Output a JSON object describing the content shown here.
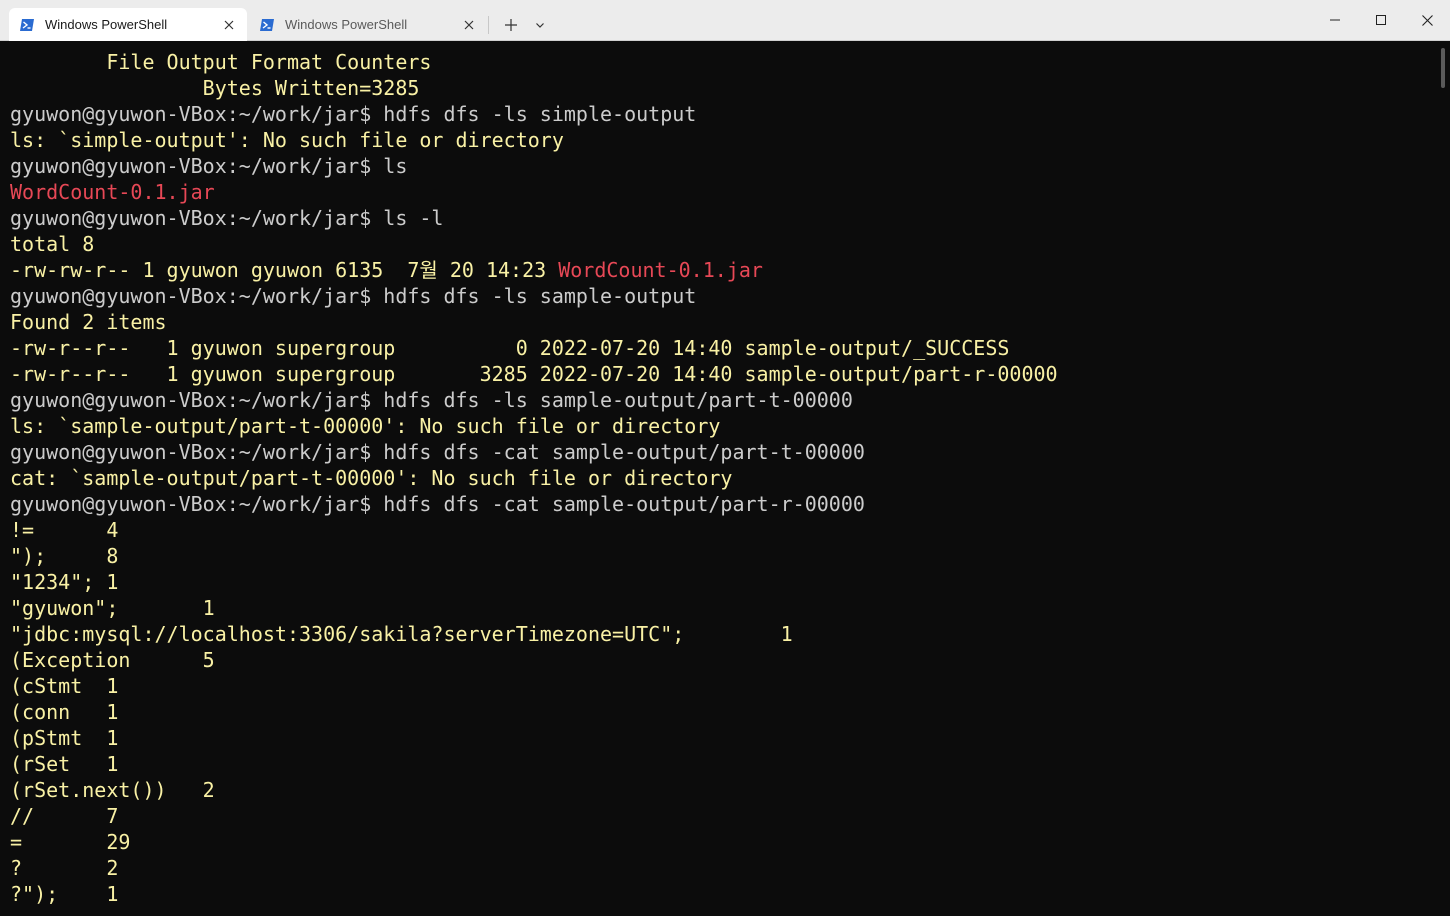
{
  "window": {
    "tabs": [
      {
        "label": "Windows PowerShell",
        "active": true
      },
      {
        "label": "Windows PowerShell",
        "active": false
      }
    ]
  },
  "colors": {
    "background": "#0c0c0c",
    "foreground": "#cccccc",
    "red": "#e74856",
    "yellow": "#f9f1a5"
  },
  "terminal": {
    "lines": [
      [
        {
          "t": "        File Output Format Counters",
          "c": "y"
        }
      ],
      [
        {
          "t": "                Bytes Written=3285",
          "c": "y"
        }
      ],
      [
        {
          "t": "gyuwon@gyuwon-VBox:~/work/jar$ hdfs dfs -ls simple-output",
          "c": ""
        }
      ],
      [
        {
          "t": "ls: `simple-output': No such file or directory",
          "c": "y"
        }
      ],
      [
        {
          "t": "gyuwon@gyuwon-VBox:~/work/jar$ ls",
          "c": ""
        }
      ],
      [
        {
          "t": "WordCount-0.1.jar",
          "c": "r"
        }
      ],
      [
        {
          "t": "gyuwon@gyuwon-VBox:~/work/jar$ ls -l",
          "c": ""
        }
      ],
      [
        {
          "t": "total 8",
          "c": "y"
        }
      ],
      [
        {
          "t": "-rw-rw-r-- 1 gyuwon gyuwon 6135  7월 20 14:23 ",
          "c": "y"
        },
        {
          "t": "WordCount-0.1.jar",
          "c": "r"
        }
      ],
      [
        {
          "t": "gyuwon@gyuwon-VBox:~/work/jar$ hdfs dfs -ls sample-output",
          "c": ""
        }
      ],
      [
        {
          "t": "Found 2 items",
          "c": "y"
        }
      ],
      [
        {
          "t": "-rw-r--r--   1 gyuwon supergroup          0 2022-07-20 14:40 sample-output/_SUCCESS",
          "c": "y"
        }
      ],
      [
        {
          "t": "-rw-r--r--   1 gyuwon supergroup       3285 2022-07-20 14:40 sample-output/part-r-00000",
          "c": "y"
        }
      ],
      [
        {
          "t": "gyuwon@gyuwon-VBox:~/work/jar$ hdfs dfs -ls sample-output/part-t-00000",
          "c": ""
        }
      ],
      [
        {
          "t": "ls: `sample-output/part-t-00000': No such file or directory",
          "c": "y"
        }
      ],
      [
        {
          "t": "gyuwon@gyuwon-VBox:~/work/jar$ hdfs dfs -cat sample-output/part-t-00000",
          "c": ""
        }
      ],
      [
        {
          "t": "cat: `sample-output/part-t-00000': No such file or directory",
          "c": "y"
        }
      ],
      [
        {
          "t": "gyuwon@gyuwon-VBox:~/work/jar$ hdfs dfs -cat sample-output/part-r-00000",
          "c": ""
        }
      ],
      [
        {
          "t": "!=      4",
          "c": "y"
        }
      ],
      [
        {
          "t": "\");     8",
          "c": "y"
        }
      ],
      [
        {
          "t": "\"1234\"; 1",
          "c": "y"
        }
      ],
      [
        {
          "t": "\"gyuwon\";       1",
          "c": "y"
        }
      ],
      [
        {
          "t": "\"jdbc:mysql://localhost:3306/sakila?serverTimezone=UTC\";        1",
          "c": "y"
        }
      ],
      [
        {
          "t": "(Exception      5",
          "c": "y"
        }
      ],
      [
        {
          "t": "(cStmt  1",
          "c": "y"
        }
      ],
      [
        {
          "t": "(conn   1",
          "c": "y"
        }
      ],
      [
        {
          "t": "(pStmt  1",
          "c": "y"
        }
      ],
      [
        {
          "t": "(rSet   1",
          "c": "y"
        }
      ],
      [
        {
          "t": "(rSet.next())   2",
          "c": "y"
        }
      ],
      [
        {
          "t": "//      7",
          "c": "y"
        }
      ],
      [
        {
          "t": "=       29",
          "c": "y"
        }
      ],
      [
        {
          "t": "?       2",
          "c": "y"
        }
      ],
      [
        {
          "t": "?\");    1",
          "c": "y"
        }
      ]
    ]
  }
}
